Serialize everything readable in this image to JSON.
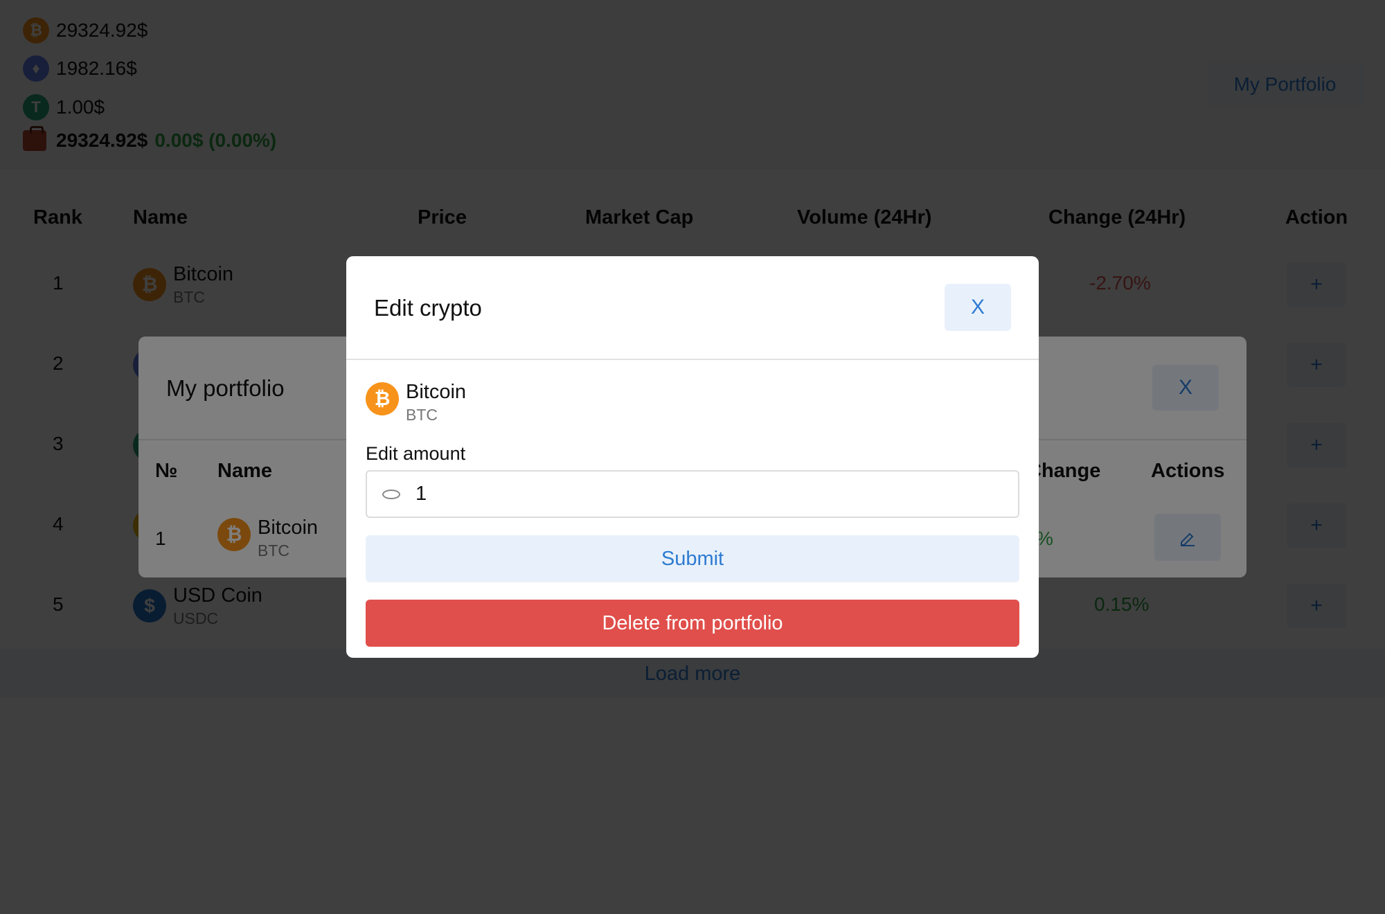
{
  "header": {
    "tickers": [
      {
        "symbol_icon": "bitcoin-icon",
        "glyph": "₿",
        "price": "29324.92$",
        "color": "#f7931a"
      },
      {
        "symbol_icon": "ethereum-icon",
        "glyph": "♦",
        "price": "1982.16$",
        "color": "#627eea"
      },
      {
        "symbol_icon": "tether-icon",
        "glyph": "T",
        "price": "1.00$",
        "color": "#26a17b"
      }
    ],
    "portfolio_total": "29324.92$",
    "portfolio_change": "0.00$ (0.00%)",
    "my_portfolio_button": "My Portfolio"
  },
  "table": {
    "headers": [
      "Rank",
      "Name",
      "Price",
      "Market Cap",
      "Volume (24Hr)",
      "Change (24Hr)",
      "Action"
    ],
    "rows": [
      {
        "rank": "1",
        "name": "Bitcoin",
        "symbol": "BTC",
        "change": "-2.70%",
        "add": "+"
      },
      {
        "rank": "2",
        "add": "+"
      },
      {
        "rank": "3",
        "add": "+"
      },
      {
        "rank": "4",
        "add": "+"
      },
      {
        "rank": "5",
        "name": "USD Coin",
        "symbol": "USDC",
        "change": "0.15%",
        "add": "+"
      }
    ],
    "load_more": "Load more"
  },
  "portfolio_modal": {
    "title": "My portfolio",
    "close": "X",
    "headers": [
      "№",
      "Name",
      "Change",
      "Actions"
    ],
    "row": {
      "number": "1",
      "name": "Bitcoin",
      "symbol": "BTC",
      "change": "%"
    }
  },
  "edit_modal": {
    "title": "Edit crypto",
    "close": "X",
    "coin_name": "Bitcoin",
    "coin_symbol": "BTC",
    "amount_label": "Edit amount",
    "amount_value": "1",
    "submit": "Submit",
    "delete": "Delete from portfolio"
  },
  "colors": {
    "accent": "#2f7bd1",
    "accent_bg": "#e8f1fb",
    "positive": "#2ea043",
    "negative": "#d9534f",
    "danger": "#e04f4b"
  }
}
